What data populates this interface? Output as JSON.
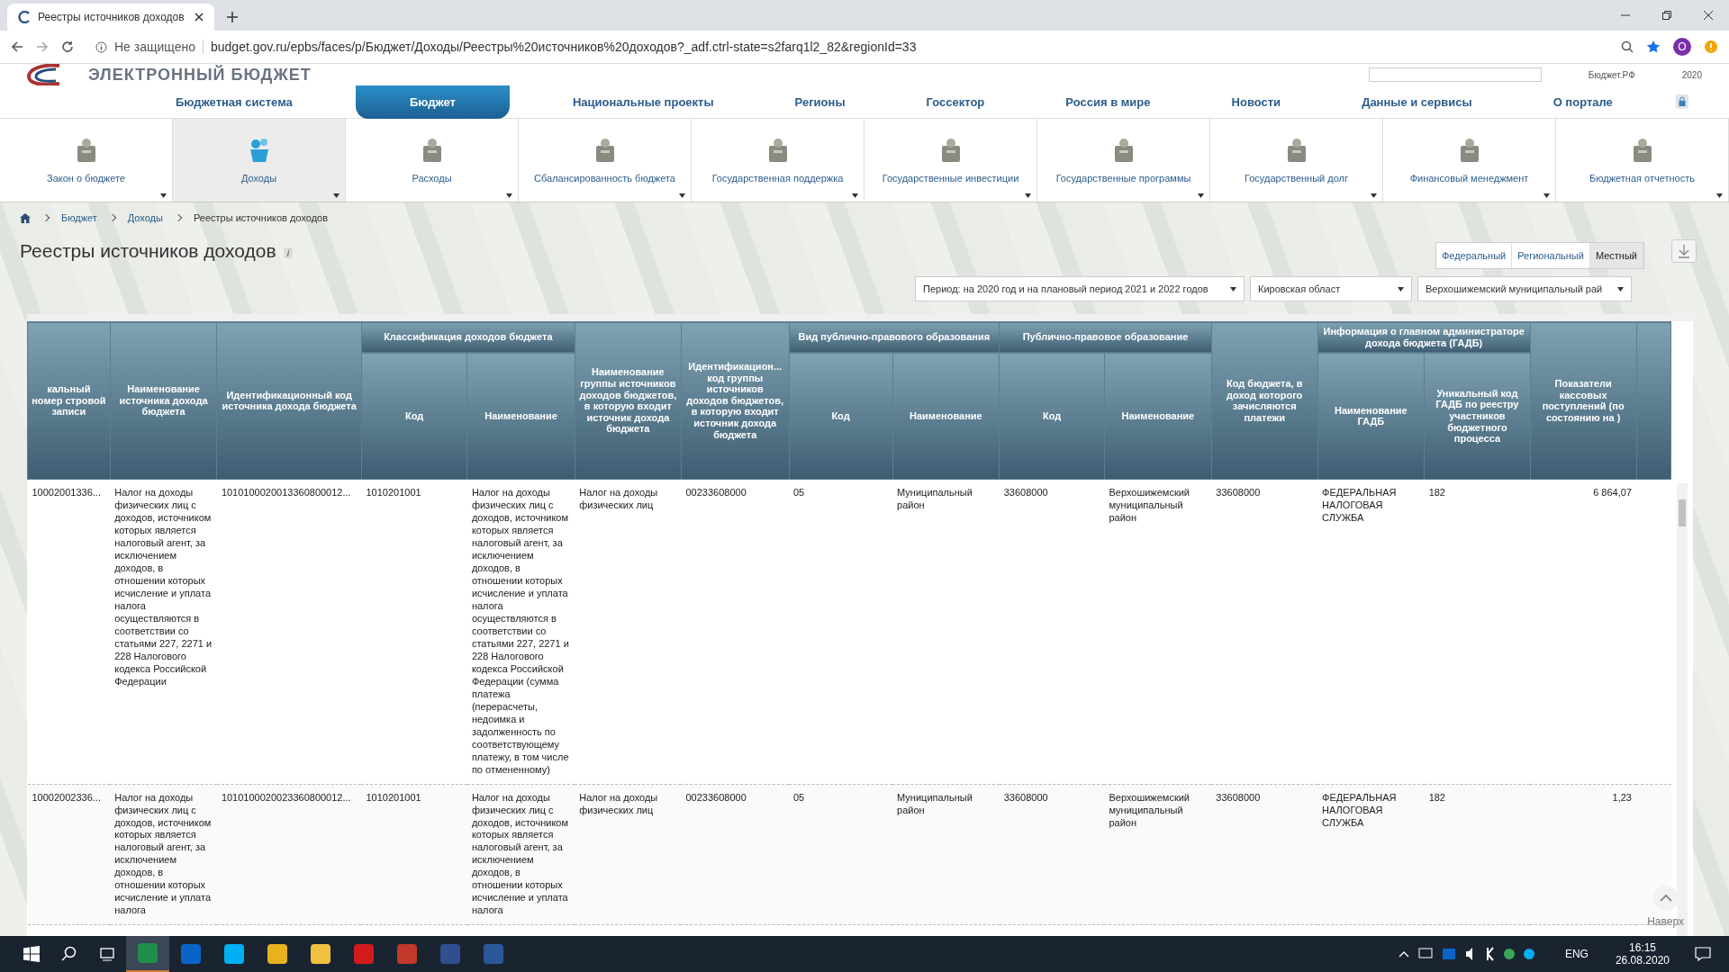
{
  "browser": {
    "tab_title": "Реестры источников доходов",
    "security": "Не защищено",
    "url": "budget.gov.ru/epbs/faces/p/Бюджет/Доходы/Реестры%20источников%20доходов?_adf.ctrl-state=s2farq1l2_82&regionId=33",
    "profile": "О"
  },
  "header": {
    "logo": "ЭЛЕКТРОННЫЙ БЮДЖЕТ",
    "site_link": "Бюджет.РФ",
    "year": "2020"
  },
  "nav": [
    {
      "label": "Бюджетная система",
      "selected": false
    },
    {
      "label": "Бюджет",
      "selected": true
    },
    {
      "label": "Национальные проекты",
      "selected": false
    },
    {
      "label": "Регионы",
      "selected": false
    },
    {
      "label": "Госсектор",
      "selected": false
    },
    {
      "label": "Россия в мире",
      "selected": false
    },
    {
      "label": "Новости",
      "selected": false
    },
    {
      "label": "Данные и сервисы",
      "selected": false
    },
    {
      "label": "О портале",
      "selected": false
    }
  ],
  "sections": [
    {
      "label": "Закон о бюджете",
      "selected": false
    },
    {
      "label": "Доходы",
      "selected": true
    },
    {
      "label": "Расходы",
      "selected": false
    },
    {
      "label": "Сбалансированность бюджета",
      "selected": false
    },
    {
      "label": "Государственная поддержка",
      "selected": false
    },
    {
      "label": "Государственные инвестиции",
      "selected": false
    },
    {
      "label": "Государственные программы",
      "selected": false
    },
    {
      "label": "Государственный долг",
      "selected": false
    },
    {
      "label": "Финансовый менеджмент",
      "selected": false
    },
    {
      "label": "Бюджетная отчетность",
      "selected": false
    }
  ],
  "breadcrumbs": [
    "Бюджет",
    "Доходы",
    "Реестры источников доходов"
  ],
  "title": "Реестры источников доходов",
  "info_icon": "i",
  "levels": [
    {
      "label": "Федеральный",
      "selected": false
    },
    {
      "label": "Региональный",
      "selected": false
    },
    {
      "label": "Местный",
      "selected": true
    }
  ],
  "filters": [
    {
      "value": "Период: на 2020 год и на плановый период 2021 и 2022 годов"
    },
    {
      "value": "Кировская област"
    },
    {
      "value": "Верхошижемский муниципальный рай"
    }
  ],
  "table": {
    "columns": [
      {
        "label": "кальный номер стровой записи"
      },
      {
        "label": "Наименование источника дохода бюджета"
      },
      {
        "label": "Идентификационный код источника дохода бюджета"
      },
      {
        "group": "Классификация доходов бюджета",
        "colspan": 2,
        "children": [
          "Код",
          "Наименование"
        ]
      },
      {
        "label": "Наименование группы источников доходов бюджетов, в которую входит источник дохода бюджета"
      },
      {
        "label": "Идентификацион... код группы источников доходов бюджетов, в которую входит источник дохода бюджета"
      },
      {
        "group": "Вид публично-правового образования",
        "colspan": 2,
        "children": [
          "Код",
          "Наименование"
        ]
      },
      {
        "group": "Публично-правовое образование",
        "colspan": 2,
        "children": [
          "Код",
          "Наименование"
        ]
      },
      {
        "label": "Код бюджета, в доход которого зачисляются платежи"
      },
      {
        "group": "Информация о главном администраторе дохода бюджета (ГАДБ)",
        "colspan": 2,
        "children": [
          "Наименование ГАДБ",
          "Уникальный код ГАДБ по реестру участников бюджетного процесса"
        ]
      },
      {
        "label": "Показатели кассовых поступлений (по состоянию на )"
      }
    ],
    "rows": [
      {
        "cells": [
          "10002001336...",
          "Налог на доходы физических лиц с доходов, источником которых является налоговый агент, за исключением доходов, в отношении которых исчисление и уплата налога осуществляются в соответствии со статьями 227, 2271 и 228 Налогового кодекса Российской Федерации",
          "1010100020013360800012...",
          "1010201001",
          "Налог на доходы физических лиц с доходов, источником которых является налоговый агент, за исключением доходов, в отношении которых исчисление и уплата налога осуществляются в соответствии со статьями 227, 2271 и 228 Налогового кодекса Российской Федерации (сумма платежа (перерасчеты, недоимка и задолженность по соответствующему платежу, в том числе по отмененному)",
          "Налог на доходы физических лиц",
          "00233608000",
          "05",
          "Муниципальный район",
          "33608000",
          "Верхошижемский муниципальный район",
          "33608000",
          "ФЕДЕРАЛЬНАЯ НАЛОГОВАЯ СЛУЖБА",
          "182",
          "6 864,07"
        ]
      },
      {
        "cells": [
          "10002002336...",
          "Налог на доходы физических лиц с доходов, источником которых является налоговый агент, за исключением доходов, в отношении которых исчисление и уплата налога",
          "1010100020023360800012...",
          "1010201001",
          "Налог на доходы физических лиц с доходов, источником которых является налоговый агент, за исключением доходов, в отношении которых исчисление и уплата налога",
          "Налог на доходы физических лиц",
          "00233608000",
          "05",
          "Муниципальный район",
          "33608000",
          "Верхошижемский муниципальный район",
          "33608000",
          "ФЕДЕРАЛЬНАЯ НАЛОГОВАЯ СЛУЖБА",
          "182",
          "1,23"
        ]
      }
    ]
  },
  "to_top": "Наверх",
  "taskbar": {
    "language": "ENG",
    "time": "16:15",
    "date": "26.08.2020"
  }
}
